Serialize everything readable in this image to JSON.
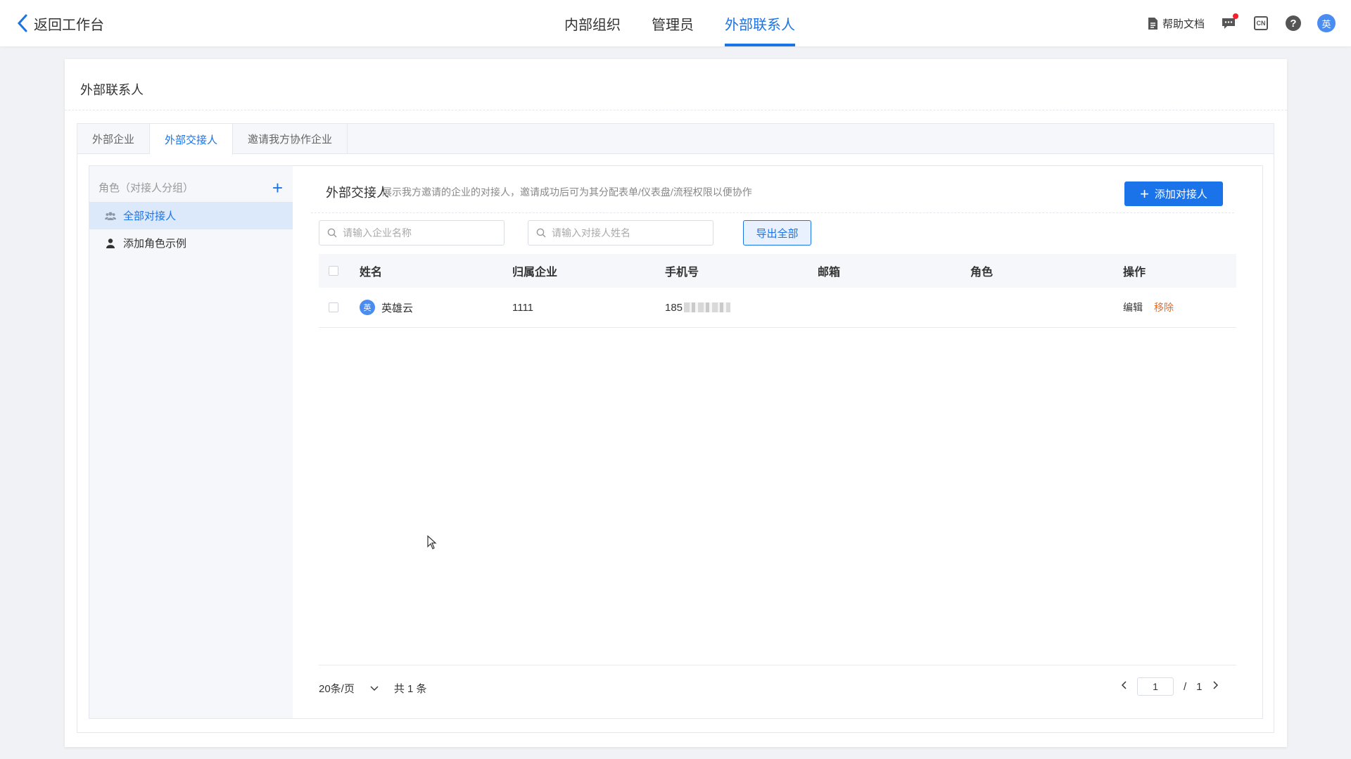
{
  "topbar": {
    "back_label": "返回工作台",
    "tabs": [
      {
        "label": "内部组织"
      },
      {
        "label": "管理员"
      },
      {
        "label": "外部联系人"
      }
    ],
    "help_doc_label": "帮助文档",
    "lang_label": "CN",
    "help_symbol": "?",
    "avatar_text": "英"
  },
  "card": {
    "title": "外部联系人",
    "sub_tabs": [
      {
        "label": "外部企业"
      },
      {
        "label": "外部交接人"
      },
      {
        "label": "邀请我方协作企业"
      }
    ]
  },
  "sidebar": {
    "header": "角色（对接人分组）",
    "add_symbol": "+",
    "items": [
      {
        "label": "全部对接人"
      },
      {
        "label": "添加角色示例"
      }
    ]
  },
  "panel": {
    "title": "外部交接人",
    "description": "展示我方邀请的企业的对接人，邀请成功后可为其分配表单/仪表盘/流程权限以便协作",
    "add_button": "添加对接人",
    "search_company_placeholder": "请输入企业名称",
    "search_contact_placeholder": "请输入对接人姓名",
    "export_button": "导出全部"
  },
  "table": {
    "headers": [
      "姓名",
      "归属企业",
      "手机号",
      "邮箱",
      "角色",
      "操作"
    ],
    "rows": [
      {
        "avatar": "英",
        "name": "英雄云",
        "enterprise": "1111",
        "phone_prefix": "185",
        "email": "",
        "role": "",
        "edit": "编辑",
        "remove": "移除"
      }
    ]
  },
  "pagination": {
    "page_size": "20条/页",
    "total": "共 1 条",
    "current_page": "1",
    "separator": "/",
    "total_pages": "1"
  },
  "colors": {
    "accent": "#1a73e8",
    "danger_link": "#e56b2a",
    "active_bg": "#dbe9fb"
  }
}
